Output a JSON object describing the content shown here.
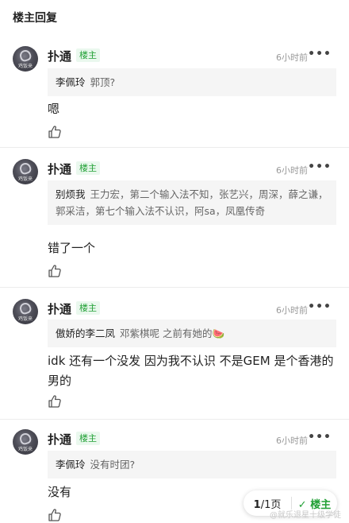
{
  "header": {
    "title": "楼主回复"
  },
  "replies": [
    {
      "avatar_tag": "鸡饭来",
      "name": "扑通",
      "badge": "楼主",
      "time": "6小时前",
      "more": "•••",
      "quote_name": "李佩玲",
      "quote_text": "郭顶?",
      "text": "嗯"
    },
    {
      "avatar_tag": "鸡饭来",
      "name": "扑通",
      "badge": "楼主",
      "time": "6小时前",
      "more": "•••",
      "quote_name": "别烦我",
      "quote_text": "王力宏，第二个输入法不知，张艺兴，周深，薛之谦，郭采洁，第七个输入法不认识，阿sa，凤凰传奇",
      "text": "错了一个"
    },
    {
      "avatar_tag": "鸡饭来",
      "name": "扑通",
      "badge": "楼主",
      "time": "6小时前",
      "more": "•••",
      "quote_name": "傲娇的李二凤",
      "quote_text": "邓紫棋呢  之前有她的🍉",
      "text": "idk 还有一个没发 因为我不认识 不是GEM 是个香港的男的"
    },
    {
      "avatar_tag": "鸡饭来",
      "name": "扑通",
      "badge": "楼主",
      "time": "6小时前",
      "more": "•••",
      "quote_name": "李佩玲",
      "quote_text": "没有时团?",
      "text": "没有"
    }
  ],
  "pager": {
    "page_current": "1",
    "page_total": "/1页",
    "filter_label": "✓ 楼主"
  },
  "watermark": "@就乐退星十级学徒"
}
